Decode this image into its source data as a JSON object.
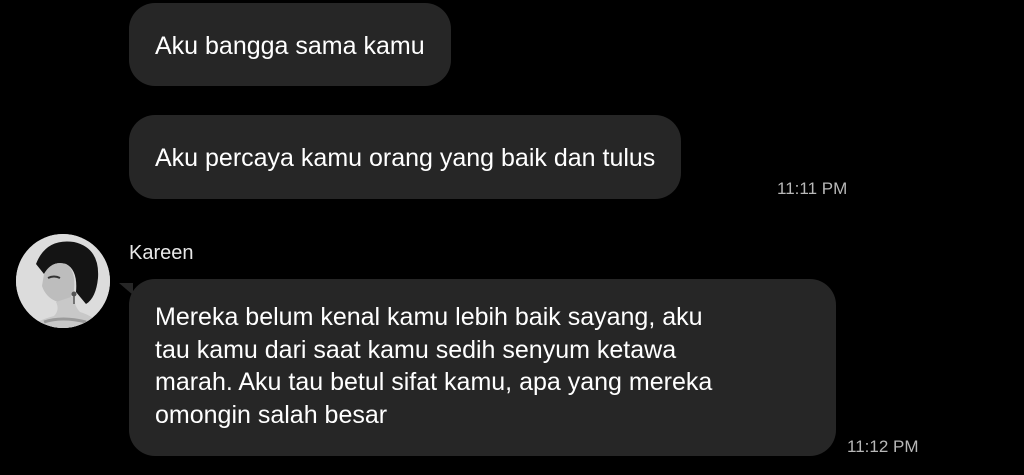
{
  "messages": [
    {
      "text": "Aku bangga sama kamu"
    },
    {
      "text": "Aku percaya kamu orang yang baik dan tulus",
      "time": "11:11 PM"
    }
  ],
  "incoming": {
    "sender": "Kareen",
    "avatar_icon": "profile-photo",
    "lines": [
      "Mereka belum kenal kamu lebih baik sayang, aku",
      "tau kamu dari saat kamu sedih senyum ketawa",
      "marah. Aku tau betul sifat kamu, apa yang mereka",
      "omongin salah besar"
    ],
    "time": "11:12 PM"
  },
  "colors": {
    "background": "#000000",
    "bubble": "#262626",
    "text": "#ffffff",
    "timestamp": "#b8b8b8"
  }
}
